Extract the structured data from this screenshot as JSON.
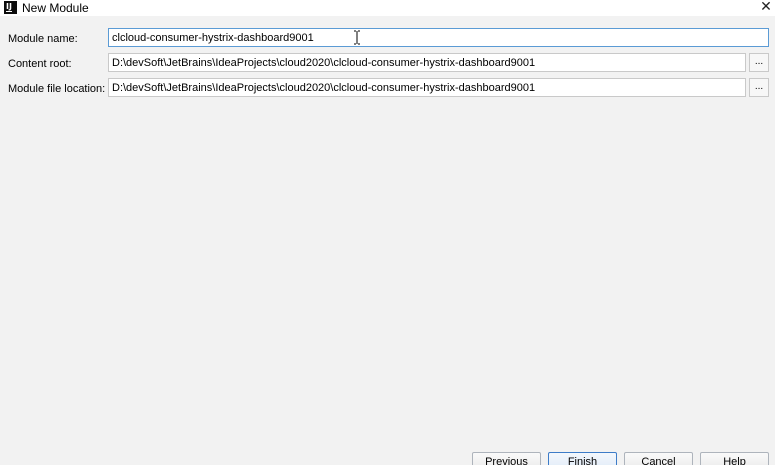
{
  "window": {
    "title": "New Module",
    "close_glyph": "✕",
    "app_icon": "intellij-idea-icon"
  },
  "form": {
    "module_name": {
      "label": "Module name:",
      "value": "clcloud-consumer-hystrix-dashboard9001"
    },
    "content_root": {
      "label": "Content root:",
      "value": "D:\\devSoft\\JetBrains\\IdeaProjects\\cloud2020\\clcloud-consumer-hystrix-dashboard9001",
      "browse_label": "..."
    },
    "module_file_location": {
      "label": "Module file location:",
      "value": "D:\\devSoft\\JetBrains\\IdeaProjects\\cloud2020\\clcloud-consumer-hystrix-dashboard9001",
      "browse_label": "..."
    }
  },
  "buttons": {
    "previous": "Previous",
    "finish": "Finish",
    "cancel": "Cancel",
    "help": "Help"
  },
  "colors": {
    "focus_border": "#5b9bd5",
    "default_button_border": "#3d7cc8",
    "background": "#f2f2f2"
  }
}
